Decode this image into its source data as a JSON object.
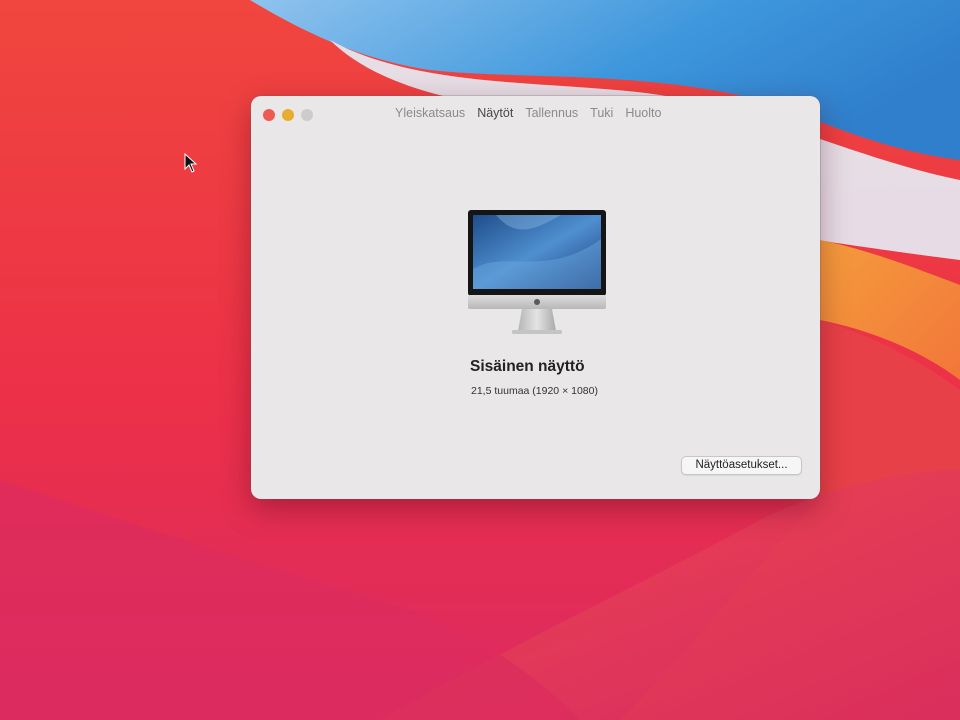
{
  "window": {
    "tabs": [
      {
        "label": "Yleiskatsaus",
        "active": false
      },
      {
        "label": "Näytöt",
        "active": true
      },
      {
        "label": "Tallennus",
        "active": false
      },
      {
        "label": "Tuki",
        "active": false
      },
      {
        "label": "Huolto",
        "active": false
      }
    ],
    "display": {
      "icon": "imac-icon",
      "name": "Sisäinen näyttö",
      "spec": "21,5 tuumaa (1920 × 1080)"
    },
    "settings_button_label": "Näyttöasetukset..."
  },
  "colors": {
    "close": "#ee5b52",
    "minimize": "#e7ad2f",
    "zoom": "#cfcbcb",
    "window_bg": "#e9e7e8"
  }
}
